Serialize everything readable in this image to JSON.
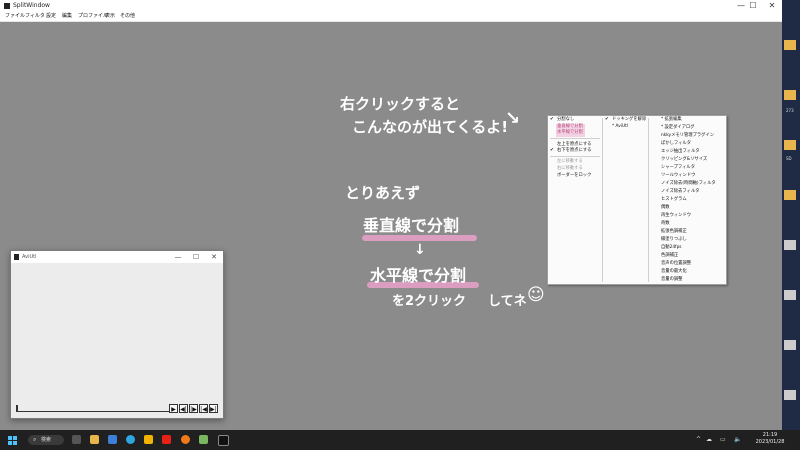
{
  "window": {
    "title": "SplitWindow",
    "minimize": "—",
    "maximize": "☐",
    "close": "✕"
  },
  "menubar": [
    "ファイル",
    "フィルタ",
    "設定",
    "編集",
    "プロファイル",
    "表示",
    "その他"
  ],
  "handwriting": {
    "line1": "右クリックすると",
    "line2": "こんなのが出てくるよ!",
    "arrow": "↘",
    "line3": "とりあえず",
    "line4": "垂直線で分割",
    "down_arrow": "↓",
    "line5": "水平線で分割",
    "line6": "を2クリック",
    "line7": "してネ",
    "smile": "☺"
  },
  "context_menu": {
    "col1": {
      "items": [
        {
          "label": "分割なし",
          "checked": true,
          "style": "normal"
        },
        {
          "label": "垂直線で分割",
          "checked": false,
          "style": "pink"
        },
        {
          "label": "水平線で分割",
          "checked": false,
          "style": "pink"
        },
        {
          "label": "左上を原点にする",
          "checked": false,
          "style": "normal"
        },
        {
          "label": "右下を原点にする",
          "checked": true,
          "style": "normal"
        },
        {
          "label": "左に移動する",
          "checked": false,
          "style": "gray"
        },
        {
          "label": "右に移動する",
          "checked": false,
          "style": "gray"
        },
        {
          "label": "ボーダーをロック",
          "checked": false,
          "style": "normal"
        }
      ]
    },
    "col2": {
      "items": [
        {
          "label": "ドッキングを解除",
          "checked": true
        },
        {
          "label": "* AviUtl",
          "checked": false
        }
      ]
    },
    "col3": {
      "items": [
        "* 拡張編集",
        "* 設定ダイアログ",
        "nkkyメモリ管理プラグイン",
        "ぼかしフィルタ",
        "エッジ抽出フィルタ",
        "クリッピング&リサイズ",
        "シャープフィルタ",
        "ツールウィンドウ",
        "ノイズ除去(時間軸)フィルタ",
        "ノイズ除去フィルタ",
        "ヒストグラム",
        "偶数",
        "再生ウィンドウ",
        "奇数",
        "拡張色調補正",
        "縁塗りつぶし",
        "自動24fps",
        "色調補正",
        "音声の位置調整",
        "音量の最大化",
        "音量の調整"
      ]
    }
  },
  "aviutl": {
    "title": "AviUtl",
    "minimize": "—",
    "maximize": "☐",
    "close": "✕",
    "controls": [
      "▶",
      "◀|",
      "|▶",
      "|◀",
      "▶|"
    ]
  },
  "taskbar": {
    "search_label": "検索",
    "time": "21:19",
    "date": "2023/01/28",
    "tray": [
      "^",
      "☁",
      "▭",
      "🔈"
    ]
  },
  "desktop": {
    "labels": [
      "273",
      "SD"
    ]
  },
  "colors": {
    "canvas": "#8b8b8b",
    "highlight": "#e3a0c5",
    "taskbar": "#202020",
    "accent": "#4cc2ff"
  }
}
